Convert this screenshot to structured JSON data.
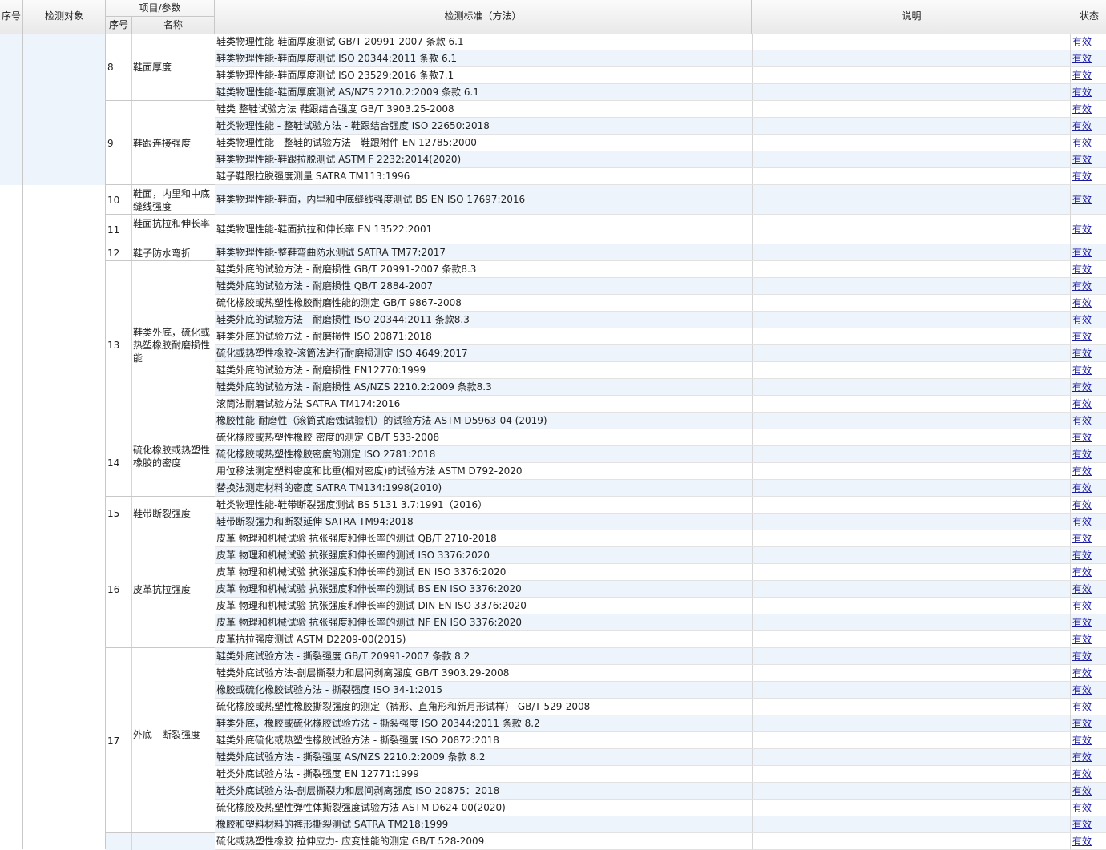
{
  "header": {
    "seq": "序号",
    "object": "检测对象",
    "item_param": "项目/参数",
    "sub_seq": "序号",
    "sub_name": "名称",
    "standard": "检测标准（方法）",
    "desc": "说明",
    "status": "状态"
  },
  "groups": [
    {
      "no": "8",
      "name": "鞋面厚度",
      "count": 4,
      "h": 21,
      "multi": false
    },
    {
      "no": "9",
      "name": "鞋跟连接强度",
      "count": 5,
      "h": 21,
      "multi": false
    },
    {
      "no": "10",
      "name": "鞋面，内里和中底缝线强度",
      "count": 1,
      "h": 37,
      "multi": true
    },
    {
      "no": "11",
      "name": "鞋面抗拉和伸长率",
      "count": 1,
      "h": 37,
      "multi": true
    },
    {
      "no": "12",
      "name": "鞋子防水弯折",
      "count": 1,
      "h": 21,
      "multi": false
    },
    {
      "no": "13",
      "name": "鞋类外底，硫化或热塑橡胶耐磨损性能",
      "count": 10,
      "h": 21,
      "multi": false
    },
    {
      "no": "14",
      "name": "硫化橡胶或热塑性橡胶的密度",
      "count": 4,
      "h": 21,
      "multi": false
    },
    {
      "no": "15",
      "name": "鞋带断裂强度",
      "count": 2,
      "h": 21,
      "multi": false
    },
    {
      "no": "16",
      "name": "皮革抗拉强度",
      "count": 7,
      "h": 21,
      "multi": false
    },
    {
      "no": "17",
      "name": "外底 - 断裂强度",
      "count": 11,
      "h": 21,
      "multi": false
    },
    {
      "no": "",
      "name": "",
      "count": 1,
      "h": 21,
      "multi": false
    }
  ],
  "rows": [
    {
      "standard": "鞋类物理性能-鞋面厚度测试 GB/T 20991-2007 条款 6.1",
      "desc": "",
      "status": "有效"
    },
    {
      "standard": "鞋类物理性能-鞋面厚度测试 ISO 20344:2011 条款 6.1",
      "desc": "",
      "status": "有效"
    },
    {
      "standard": "鞋类物理性能-鞋面厚度测试 ISO 23529:2016 条款7.1",
      "desc": "",
      "status": "有效"
    },
    {
      "standard": "鞋类物理性能-鞋面厚度测试 AS/NZS 2210.2:2009 条款 6.1",
      "desc": "",
      "status": "有效"
    },
    {
      "standard": "鞋类 整鞋试验方法 鞋跟结合强度 GB/T 3903.25-2008",
      "desc": "",
      "status": "有效"
    },
    {
      "standard": "鞋类物理性能 - 整鞋试验方法 - 鞋跟结合强度 ISO 22650:2018",
      "desc": "",
      "status": "有效"
    },
    {
      "standard": "鞋类物理性能 - 整鞋的试验方法 - 鞋跟附件 EN 12785:2000",
      "desc": "",
      "status": "有效"
    },
    {
      "standard": "鞋类物理性能-鞋跟拉脱测试 ASTM F 2232:2014(2020)",
      "desc": "",
      "status": "有效"
    },
    {
      "standard": "鞋子鞋跟拉脱强度测量 SATRA TM113:1996",
      "desc": "",
      "status": "有效"
    },
    {
      "standard": "鞋类物理性能-鞋面，内里和中底缝线强度测试 BS EN ISO 17697:2016",
      "desc": "",
      "status": "有效"
    },
    {
      "standard": "鞋类物理性能-鞋面抗拉和伸长率 EN 13522:2001",
      "desc": "",
      "status": "有效"
    },
    {
      "standard": "鞋类物理性能-整鞋弯曲防水测试 SATRA TM77:2017",
      "desc": "",
      "status": "有效"
    },
    {
      "standard": "鞋类外底的试验方法 - 耐磨损性 GB/T 20991-2007 条款8.3",
      "desc": "",
      "status": "有效"
    },
    {
      "standard": "鞋类外底的试验方法 - 耐磨损性 QB/T 2884-2007",
      "desc": "",
      "status": "有效"
    },
    {
      "standard": "硫化橡胶或热塑性橡胶耐磨性能的测定 GB/T 9867-2008",
      "desc": "",
      "status": "有效"
    },
    {
      "standard": "鞋类外底的试验方法 - 耐磨损性 ISO 20344:2011 条款8.3",
      "desc": "",
      "status": "有效"
    },
    {
      "standard": "鞋类外底的试验方法 - 耐磨损性 ISO 20871:2018",
      "desc": "",
      "status": "有效"
    },
    {
      "standard": "硫化或热塑性橡胶-滚筒法进行耐磨损测定 ISO 4649:2017",
      "desc": "",
      "status": "有效"
    },
    {
      "standard": "鞋类外底的试验方法 - 耐磨损性 EN12770:1999",
      "desc": "",
      "status": "有效"
    },
    {
      "standard": "鞋类外底的试验方法 - 耐磨损性 AS/NZS 2210.2:2009 条款8.3",
      "desc": "",
      "status": "有效"
    },
    {
      "standard": "滚筒法耐磨试验方法 SATRA TM174:2016",
      "desc": "",
      "status": "有效"
    },
    {
      "standard": "橡胶性能-耐磨性（滚筒式磨蚀试验机）的试验方法 ASTM D5963-04 (2019)",
      "desc": "",
      "status": "有效"
    },
    {
      "standard": "硫化橡胶或热塑性橡胶 密度的测定 GB/T 533-2008",
      "desc": "",
      "status": "有效"
    },
    {
      "standard": "硫化橡胶或热塑性橡胶密度的测定 ISO 2781:2018",
      "desc": "",
      "status": "有效"
    },
    {
      "standard": "用位移法测定塑料密度和比重(相对密度)的试验方法 ASTM D792-2020",
      "desc": "",
      "status": "有效"
    },
    {
      "standard": "替换法测定材料的密度 SATRA TM134:1998(2010)",
      "desc": "",
      "status": "有效"
    },
    {
      "standard": "鞋类物理性能-鞋带断裂强度测试 BS 5131 3.7:1991（2016）",
      "desc": "",
      "status": "有效"
    },
    {
      "standard": "鞋带断裂强力和断裂延伸 SATRA TM94:2018",
      "desc": "",
      "status": "有效"
    },
    {
      "standard": "皮革 物理和机械试验 抗张强度和伸长率的测试 QB/T 2710-2018",
      "desc": "",
      "status": "有效"
    },
    {
      "standard": "皮革 物理和机械试验 抗张强度和伸长率的测试 ISO 3376:2020",
      "desc": "",
      "status": "有效"
    },
    {
      "standard": "皮革 物理和机械试验 抗张强度和伸长率的测试 EN ISO 3376:2020",
      "desc": "",
      "status": "有效"
    },
    {
      "standard": "皮革 物理和机械试验 抗张强度和伸长率的测试 BS EN ISO 3376:2020",
      "desc": "",
      "status": "有效"
    },
    {
      "standard": "皮革 物理和机械试验 抗张强度和伸长率的测试 DIN EN ISO 3376:2020",
      "desc": "",
      "status": "有效"
    },
    {
      "standard": "皮革 物理和机械试验 抗张强度和伸长率的测试 NF EN ISO 3376:2020",
      "desc": "",
      "status": "有效"
    },
    {
      "standard": "皮革抗拉强度测试 ASTM D2209-00(2015)",
      "desc": "",
      "status": "有效"
    },
    {
      "standard": "鞋类外底试验方法 - 撕裂强度 GB/T 20991-2007 条款 8.2",
      "desc": "",
      "status": "有效"
    },
    {
      "standard": "鞋类外底试验方法-剖层撕裂力和层间剥离强度 GB/T 3903.29-2008",
      "desc": "",
      "status": "有效"
    },
    {
      "standard": "橡胶或硫化橡胶试验方法 - 撕裂强度 ISO 34-1:2015",
      "desc": "",
      "status": "有效"
    },
    {
      "standard": "硫化橡胶或热塑性橡胶撕裂强度的测定（裤形、直角形和新月形试样） GB/T 529-2008",
      "desc": "",
      "status": "有效"
    },
    {
      "standard": "鞋类外底，橡胶或硫化橡胶试验方法 - 撕裂强度 ISO 20344:2011 条款 8.2",
      "desc": "",
      "status": "有效"
    },
    {
      "standard": "鞋类外底硫化或热塑性橡胶试验方法 - 撕裂强度 ISO 20872:2018",
      "desc": "",
      "status": "有效"
    },
    {
      "standard": "鞋类外底试验方法 - 撕裂强度 AS/NZS 2210.2:2009 条款 8.2",
      "desc": "",
      "status": "有效"
    },
    {
      "standard": "鞋类外底试验方法 - 撕裂强度 EN 12771:1999",
      "desc": "",
      "status": "有效"
    },
    {
      "standard": "鞋类外底试验方法-剖层撕裂力和层间剥离强度 ISO 20875：2018",
      "desc": "",
      "status": "有效"
    },
    {
      "standard": "硫化橡胶及热塑性弹性体撕裂强度试验方法 ASTM D624-00(2020)",
      "desc": "",
      "status": "有效"
    },
    {
      "standard": "橡胶和塑料材料的裤形撕裂测试 SATRA TM218:1999",
      "desc": "",
      "status": "有效"
    },
    {
      "standard": "硫化或热塑性橡胶 拉伸应力- 应变性能的测定 GB/T 528-2009",
      "desc": "",
      "status": "有效"
    }
  ]
}
